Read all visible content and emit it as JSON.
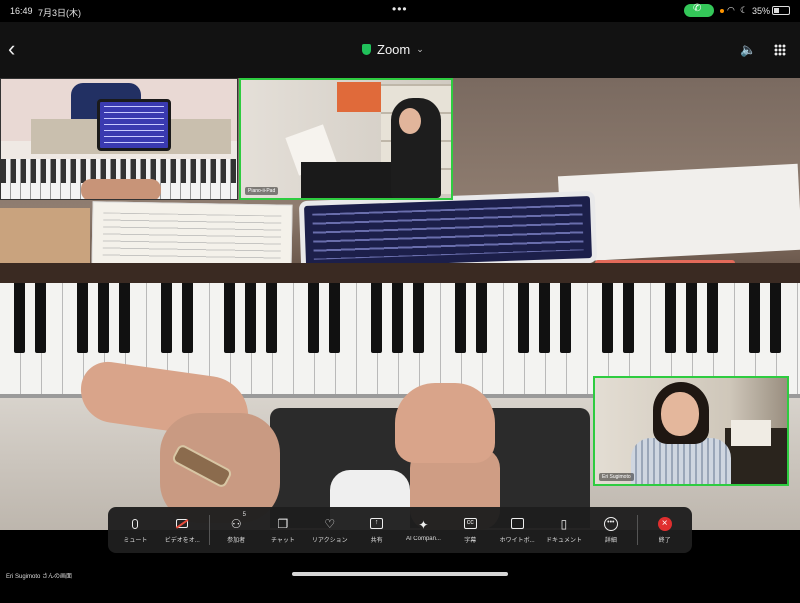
{
  "status_bar": {
    "time": "16:49",
    "date": "7月3日(木)",
    "dots": "•••",
    "battery_pct": "35%"
  },
  "header": {
    "app_title": "Zoom",
    "back_icon": "chevron-left-icon",
    "speaker_icon": "speaker-icon",
    "grid_icon": "grid-view-icon"
  },
  "participants": [
    {
      "label": "Piano-ii-Pad"
    },
    {
      "label": "Eri Sugimoto"
    }
  ],
  "toolbar": {
    "items": [
      {
        "label": "ミュート",
        "icon": "microphone-icon"
      },
      {
        "label": "ビデオをオ...",
        "icon": "video-off-icon"
      },
      {
        "label": "参加者",
        "icon": "participants-icon",
        "badge": "5"
      },
      {
        "label": "チャット",
        "icon": "chat-icon"
      },
      {
        "label": "リアクション",
        "icon": "reaction-heart-icon"
      },
      {
        "label": "共有",
        "icon": "share-icon"
      },
      {
        "label": "AI Compan...",
        "icon": "ai-companion-icon"
      },
      {
        "label": "字幕",
        "icon": "captions-icon"
      },
      {
        "label": "ホワイトボ...",
        "icon": "whiteboard-icon"
      },
      {
        "label": "ドキュメント",
        "icon": "document-icon"
      },
      {
        "label": "詳細",
        "icon": "more-icon"
      },
      {
        "label": "終了",
        "icon": "end-call-icon"
      }
    ]
  },
  "footer": {
    "screen_owner": "Eri Sugimoto さんの画面"
  },
  "colors": {
    "active_speaker_border": "#2ecc40",
    "end_button": "#e02f2f",
    "call_pill": "#34c759",
    "secure_shield": "#20c15a"
  }
}
